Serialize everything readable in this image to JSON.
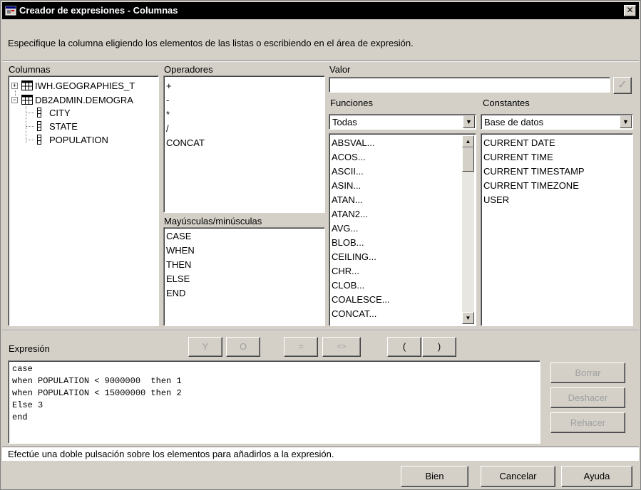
{
  "window": {
    "title": "Creador de expresiones - Columnas",
    "close_glyph": "✕"
  },
  "instruction": "Especifique la columna eligiendo los elementos de las listas o escribiendo en el área de expresión.",
  "columns": {
    "label": "Columnas",
    "tables": [
      {
        "name": "IWH.GEOGRAPHIES_T",
        "expander": "+"
      },
      {
        "name": "DB2ADMIN.DEMOGRA",
        "expander": "−"
      }
    ],
    "fields": [
      "CITY",
      "STATE",
      "POPULATION"
    ]
  },
  "operators": {
    "label": "Operadores",
    "items": [
      "+",
      "-",
      "*",
      "/",
      "CONCAT"
    ]
  },
  "case_list": {
    "label": "Mayúsculas/minúsculas",
    "items": [
      "CASE",
      "WHEN",
      "THEN",
      "ELSE",
      "END"
    ]
  },
  "value": {
    "label": "Valor",
    "text": "",
    "apply_glyph": "✓"
  },
  "functions": {
    "label": "Funciones",
    "filter": "Todas",
    "items": [
      "ABSVAL...",
      "ACOS...",
      "ASCII...",
      "ASIN...",
      "ATAN...",
      "ATAN2...",
      "AVG...",
      "BLOB...",
      "CEILING...",
      "CHR...",
      "CLOB...",
      "COALESCE...",
      "CONCAT..."
    ]
  },
  "constants": {
    "label": "Constantes",
    "filter": "Base de datos",
    "items": [
      "CURRENT DATE",
      "CURRENT TIME",
      "CURRENT TIMESTAMP",
      "CURRENT TIMEZONE",
      "USER"
    ]
  },
  "expression": {
    "label": "Expresión",
    "operator_buttons": [
      "Y",
      "O",
      "=",
      "<>",
      "(",
      ")"
    ],
    "lines": [
      "case",
      "when POPULATION < 9000000  then 1",
      "when POPULATION < 15000000 then 2",
      "Else 3",
      "end"
    ],
    "clear": "Borrar",
    "undo": "Deshacer",
    "redo": "Rehacer"
  },
  "status_text": "Efectúe una doble pulsación sobre los elementos para añadirlos a la expresión.",
  "footer": {
    "ok": "Bien",
    "cancel": "Cancelar",
    "help": "Ayuda"
  },
  "icons": {
    "app": "app-window-icon",
    "table": "table-icon",
    "column": "column-icon",
    "dropdown": "dropdown-arrow-icon"
  },
  "colors": {
    "titlebar": "#000000",
    "face": "#d4d0c8",
    "list_bg": "#ffffff"
  }
}
